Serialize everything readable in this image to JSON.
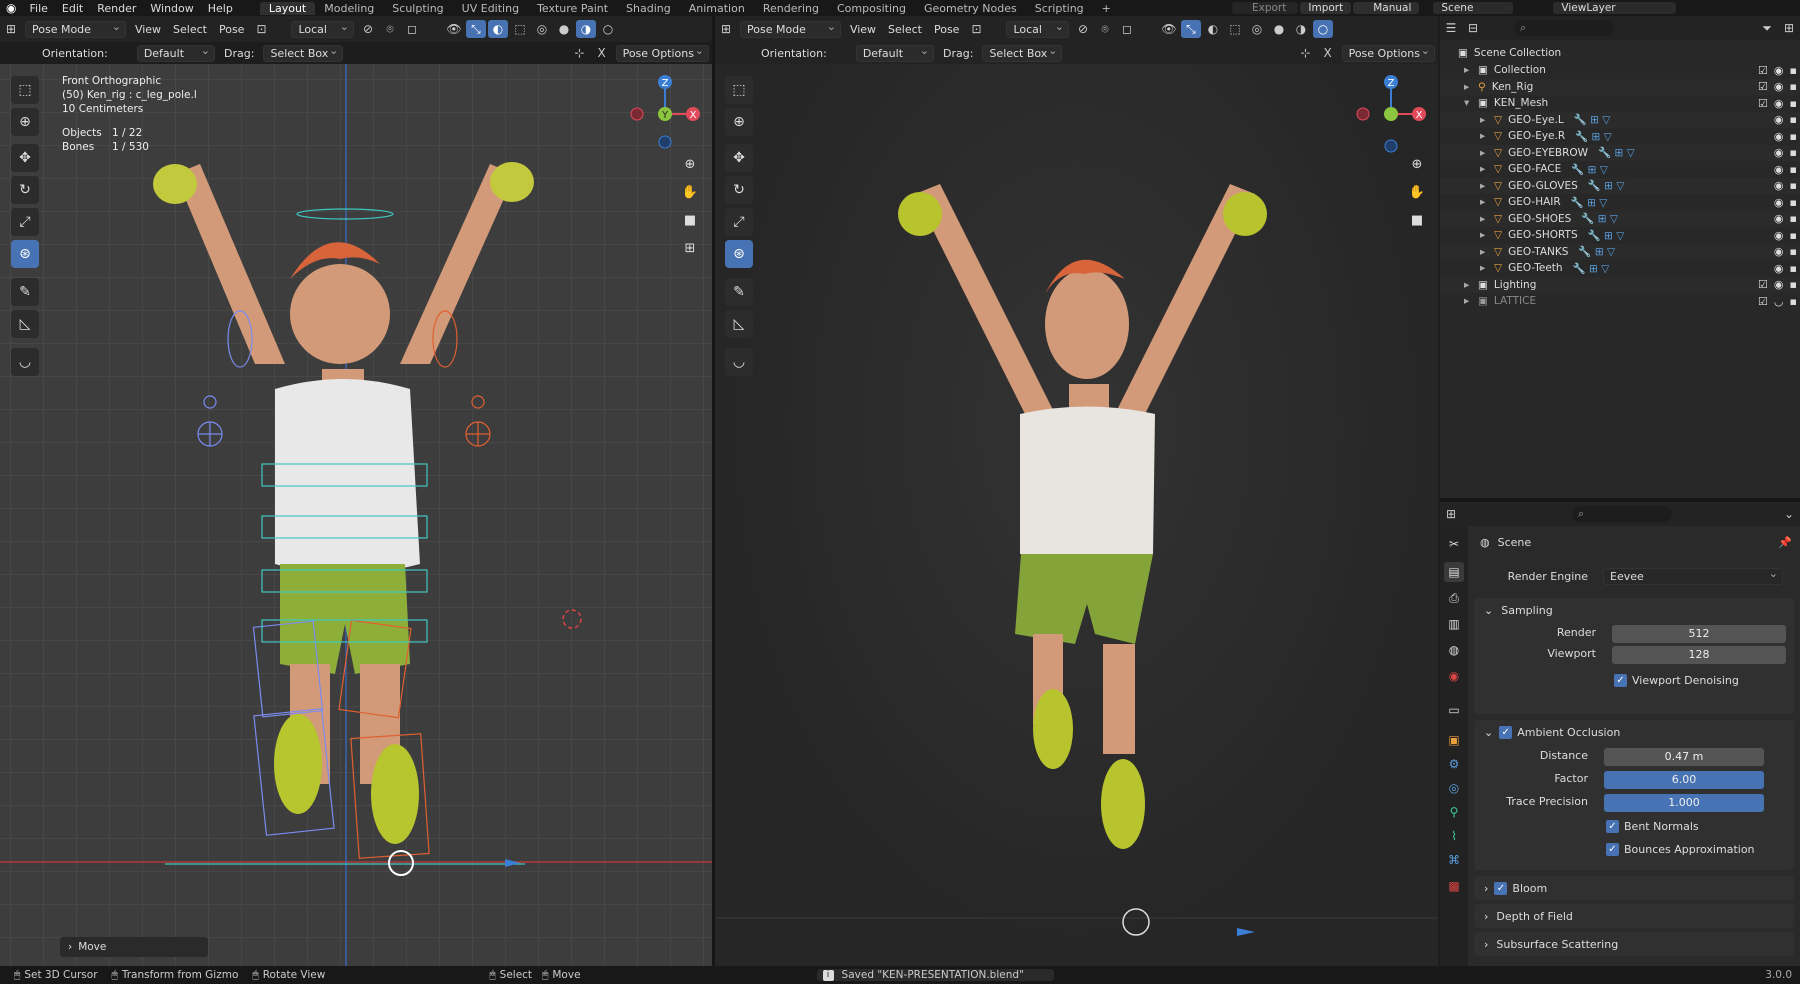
{
  "topbar": {
    "menus": [
      "File",
      "Edit",
      "Render",
      "Window",
      "Help"
    ],
    "workspaces": [
      "Layout",
      "Modeling",
      "Sculpting",
      "UV Editing",
      "Texture Paint",
      "Shading",
      "Animation",
      "Rendering",
      "Compositing",
      "Geometry Nodes",
      "Scripting"
    ],
    "active_workspace": "Layout",
    "add_tab": "+",
    "right": {
      "export": "Export",
      "import": "Import",
      "manual": "Manual",
      "scene": "Scene",
      "view_layer": "ViewLayer"
    }
  },
  "left_viewport": {
    "mode": "Pose Mode",
    "menus": [
      "View",
      "Select",
      "Pose"
    ],
    "transform_orientation": "Local",
    "orientation_label": "Orientation:",
    "orientation_value": "Default",
    "drag_label": "Drag:",
    "drag_value": "Select Box",
    "pose_options": "Pose Options",
    "overlay": {
      "view_name": "Front Orthographic",
      "active": "(50) Ken_rig : c_leg_pole.l",
      "scale": "10 Centimeters",
      "objects_label": "Objects",
      "objects_value": "1 / 22",
      "bones_label": "Bones",
      "bones_value": "1 / 530"
    },
    "last_operator": "Move"
  },
  "right_viewport": {
    "mode": "Pose Mode",
    "menus": [
      "View",
      "Select",
      "Pose"
    ],
    "transform_orientation": "Local",
    "orientation_label": "Orientation:",
    "orientation_value": "Default",
    "drag_label": "Drag:",
    "drag_value": "Select Box",
    "pose_options": "Pose Options"
  },
  "gizmo": {
    "x": "X",
    "y": "Y",
    "z": "Z"
  },
  "outliner": {
    "root": "Scene Collection",
    "rows": [
      {
        "name": "Collection",
        "indent": 1,
        "expand": "▸",
        "hidden": false
      },
      {
        "name": "Ken_Rig",
        "indent": 1,
        "expand": "▸",
        "hidden": false
      },
      {
        "name": "KEN_Mesh",
        "indent": 1,
        "expand": "▾",
        "hidden": false
      },
      {
        "name": "GEO-Eye.L",
        "indent": 2,
        "expand": "▸",
        "hidden": false
      },
      {
        "name": "GEO-Eye.R",
        "indent": 2,
        "expand": "▸",
        "hidden": false
      },
      {
        "name": "GEO-EYEBROW",
        "indent": 2,
        "expand": "▸",
        "hidden": false
      },
      {
        "name": "GEO-FACE",
        "indent": 2,
        "expand": "▸",
        "hidden": false
      },
      {
        "name": "GEO-GLOVES",
        "indent": 2,
        "expand": "▸",
        "hidden": false
      },
      {
        "name": "GEO-HAIR",
        "indent": 2,
        "expand": "▸",
        "hidden": false
      },
      {
        "name": "GEO-SHOES",
        "indent": 2,
        "expand": "▸",
        "hidden": false
      },
      {
        "name": "GEO-SHORTS",
        "indent": 2,
        "expand": "▸",
        "hidden": false
      },
      {
        "name": "GEO-TANKS",
        "indent": 2,
        "expand": "▸",
        "hidden": false
      },
      {
        "name": "GEO-Teeth",
        "indent": 2,
        "expand": "▸",
        "hidden": false
      },
      {
        "name": "Lighting",
        "indent": 1,
        "expand": "▸",
        "hidden": false
      },
      {
        "name": "LATTICE",
        "indent": 1,
        "expand": "▸",
        "hidden": true
      }
    ]
  },
  "properties": {
    "context": "Scene",
    "render_engine_label": "Render Engine",
    "render_engine_value": "Eevee",
    "sampling": {
      "title": "Sampling",
      "render_label": "Render",
      "render_value": "512",
      "viewport_label": "Viewport",
      "viewport_value": "128",
      "denoise_label": "Viewport Denoising"
    },
    "ao": {
      "title": "Ambient Occlusion",
      "distance_label": "Distance",
      "distance_value": "0.47 m",
      "factor_label": "Factor",
      "factor_value": "6.00",
      "trace_label": "Trace Precision",
      "trace_value": "1.000",
      "bent_label": "Bent Normals",
      "bounces_label": "Bounces Approximation"
    },
    "bloom": "Bloom",
    "dof": "Depth of Field",
    "sss": "Subsurface Scattering"
  },
  "statusbar": {
    "items": [
      "Set 3D Cursor",
      "Transform from Gizmo",
      "Rotate View",
      "Select",
      "Move"
    ],
    "message": "Saved \"KEN-PRESENTATION.blend\"",
    "version": "3.0.0"
  },
  "colors": {
    "accent": "#4772b3",
    "x_axis": "#e04a5a",
    "y_axis": "#8cc63f",
    "z_axis": "#3a7fd5"
  }
}
